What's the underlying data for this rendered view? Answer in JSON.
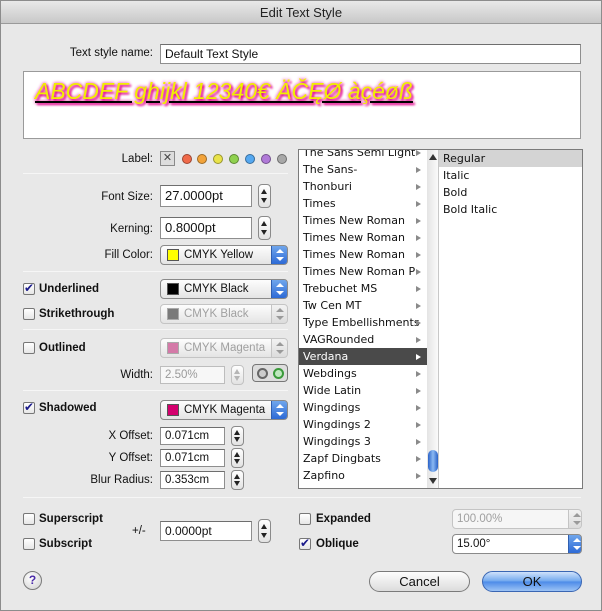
{
  "window": {
    "title": "Edit Text Style"
  },
  "style_name": {
    "label": "Text style name:",
    "value": "Default Text Style"
  },
  "preview": {
    "sample": "ABCDEF ghijkl 12340€ ÄČĘØ àçéøß"
  },
  "label_row": {
    "label": "Label:",
    "none_symbol": "✕",
    "colors": [
      "#7b7b7b",
      "#f06a4a",
      "#f2a33a",
      "#e9e34a",
      "#8fd14f",
      "#55a8f0",
      "#b07ad8",
      "#a8a8a8"
    ]
  },
  "font_size": {
    "label": "Font Size:",
    "value": "27.0000pt"
  },
  "kerning": {
    "label": "Kerning:",
    "value": "0.8000pt"
  },
  "fill_color": {
    "label": "Fill Color:",
    "value": "CMYK Yellow",
    "swatch": "#ffff00"
  },
  "underlined": {
    "label": "Underlined",
    "checked": true,
    "color": "CMYK Black",
    "swatch": "#000000"
  },
  "strikethrough": {
    "label": "Strikethrough",
    "checked": false,
    "color": "CMYK Black",
    "swatch": "#7a7a7a"
  },
  "outlined": {
    "label": "Outlined",
    "checked": false,
    "color": "CMYK Magenta",
    "swatch": "#d47aa8",
    "width_label": "Width:",
    "width_value": "2.50%"
  },
  "shadowed": {
    "label": "Shadowed",
    "checked": true,
    "color": "CMYK Magenta",
    "swatch": "#d4006e",
    "x_label": "X Offset:",
    "x_value": "0.071cm",
    "y_label": "Y Offset:",
    "y_value": "0.071cm",
    "blur_label": "Blur Radius:",
    "blur_value": "0.353cm"
  },
  "fonts": [
    "The Sans Semi Light-",
    "The Sans-",
    "Thonburi",
    "Times",
    "Times New Roman",
    "Times New Roman",
    "Times New Roman",
    "Times New Roman P",
    "Trebuchet MS",
    "Tw Cen MT",
    "Type Embellishments",
    "VAGRounded",
    "Verdana",
    "Webdings",
    "Wide Latin",
    "Wingdings",
    "Wingdings 2",
    "Wingdings 3",
    "Zapf Dingbats",
    "Zapfino"
  ],
  "selected_font": "Verdana",
  "styles": [
    "Regular",
    "Italic",
    "Bold",
    "Bold Italic"
  ],
  "selected_style": "Regular",
  "superscript": {
    "label": "Superscript",
    "checked": false
  },
  "subscript": {
    "label": "Subscript",
    "checked": false
  },
  "baseline": {
    "label": "+/-",
    "value": "0.0000pt"
  },
  "expanded": {
    "label": "Expanded",
    "checked": false,
    "value": "100.00%"
  },
  "oblique": {
    "label": "Oblique",
    "checked": true,
    "value": "15.00°"
  },
  "buttons": {
    "help": "?",
    "cancel": "Cancel",
    "ok": "OK"
  }
}
